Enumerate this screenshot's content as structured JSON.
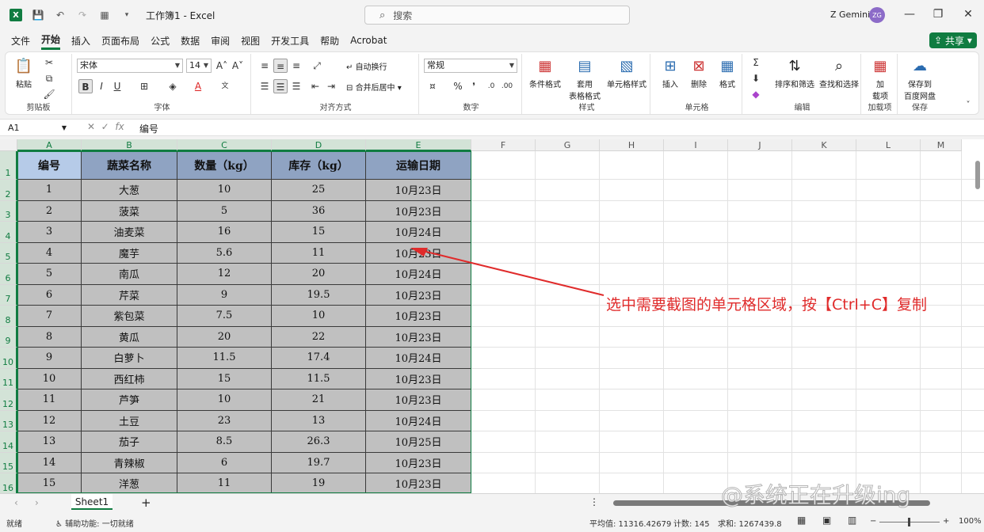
{
  "titlebar": {
    "doc_title": "工作簿1  -  Excel",
    "search_placeholder": "搜索",
    "user": "Z Gemini",
    "avatar_initials": "ZG"
  },
  "menu": {
    "tabs": [
      "文件",
      "开始",
      "插入",
      "页面布局",
      "公式",
      "数据",
      "审阅",
      "视图",
      "开发工具",
      "帮助",
      "Acrobat"
    ],
    "active": "开始",
    "share": "共享"
  },
  "ribbon": {
    "clipboard": {
      "paste": "粘贴",
      "label": "剪贴板"
    },
    "font": {
      "family": "宋体",
      "size": "14",
      "label": "字体"
    },
    "align": {
      "wrap": "自动换行",
      "merge": "合并后居中",
      "label": "对齐方式"
    },
    "number": {
      "format": "常规",
      "label": "数字"
    },
    "styles": {
      "cond": "条件格式",
      "table1": "套用",
      "table2": "表格格式",
      "cell_style": "单元格样式",
      "label": "样式"
    },
    "cells": {
      "insert": "插入",
      "delete": "删除",
      "format": "格式",
      "label": "单元格"
    },
    "editing": {
      "sort": "排序和筛选",
      "find": "查找和选择",
      "label": "编辑"
    },
    "addins": {
      "b1": "加",
      "b2": "载项",
      "label": "加载项"
    },
    "save": {
      "b1": "保存到",
      "b2": "百度网盘",
      "label": "保存"
    }
  },
  "formula_bar": {
    "name_box": "A1",
    "value": "编号"
  },
  "columns": [
    "A",
    "B",
    "C",
    "D",
    "E",
    "F",
    "G",
    "H",
    "I",
    "J",
    "K",
    "L",
    "M"
  ],
  "rows": [
    "1",
    "2",
    "3",
    "4",
    "5",
    "6",
    "7",
    "8",
    "9",
    "10",
    "11",
    "12",
    "13",
    "14",
    "15",
    "16"
  ],
  "table": {
    "headers": [
      "编号",
      "蔬菜名称",
      "数量（kg）",
      "库存（kg）",
      "运输日期"
    ],
    "rows": [
      [
        "1",
        "大葱",
        "10",
        "25",
        "10月23日"
      ],
      [
        "2",
        "菠菜",
        "5",
        "36",
        "10月23日"
      ],
      [
        "3",
        "油麦菜",
        "16",
        "15",
        "10月24日"
      ],
      [
        "4",
        "魔芋",
        "5.6",
        "11",
        "10月23日"
      ],
      [
        "5",
        "南瓜",
        "12",
        "20",
        "10月24日"
      ],
      [
        "6",
        "芹菜",
        "9",
        "19.5",
        "10月23日"
      ],
      [
        "7",
        "紫包菜",
        "7.5",
        "10",
        "10月23日"
      ],
      [
        "8",
        "黄瓜",
        "20",
        "22",
        "10月23日"
      ],
      [
        "9",
        "白萝卜",
        "11.5",
        "17.4",
        "10月24日"
      ],
      [
        "10",
        "西红柿",
        "15",
        "11.5",
        "10月23日"
      ],
      [
        "11",
        "芦笋",
        "10",
        "21",
        "10月23日"
      ],
      [
        "12",
        "土豆",
        "23",
        "13",
        "10月24日"
      ],
      [
        "13",
        "茄子",
        "8.5",
        "26.3",
        "10月25日"
      ],
      [
        "14",
        "青辣椒",
        "6",
        "19.7",
        "10月23日"
      ],
      [
        "15",
        "洋葱",
        "11",
        "19",
        "10月23日"
      ]
    ]
  },
  "annotation": "选中需要截图的单元格区域，按【Ctrl+C】复制",
  "sheet_tab": "Sheet1",
  "watermark": "@系统正在升级ing",
  "status": {
    "ready": "就绪",
    "accessibility": "辅助功能: 一切就绪",
    "average": "平均值: 11316.42679",
    "count": "计数: 145",
    "sum": "求和: 1267439.8",
    "zoom": "100%"
  },
  "colors": {
    "accent": "#107c41",
    "annotation": "#e02b2b",
    "header_fill": "#8fa3c2",
    "cell_fill": "#c0c0c0"
  }
}
